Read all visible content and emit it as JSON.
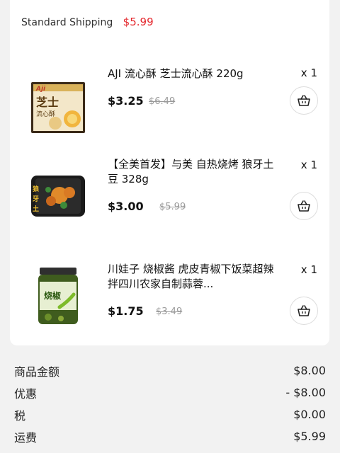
{
  "shipping": {
    "label": "Standard Shipping",
    "price": "$5.99"
  },
  "items": [
    {
      "title": "AJI 流心酥 芝士流心酥  220g",
      "qty": "x 1",
      "price": "$3.25",
      "orig_price": "$6.49"
    },
    {
      "title": "【全美首发】与美 自热烧烤 狼牙土豆 328g",
      "qty": "x 1",
      "price": "$3.00",
      "orig_price": "$5.99"
    },
    {
      "title": "川娃子 烧椒酱 虎皮青椒下饭菜超辣拌四川农家自制蒜蓉...",
      "qty": "x 1",
      "price": "$1.75",
      "orig_price": "$3.49"
    }
  ],
  "summary": [
    {
      "label": "商品金额",
      "value": "$8.00"
    },
    {
      "label": "优惠",
      "value": "- $8.00"
    },
    {
      "label": "税",
      "value": "$0.00"
    },
    {
      "label": "运费",
      "value": "$5.99"
    }
  ],
  "colors": {
    "accent": "#e4262c",
    "background": "#f2f2f2",
    "card": "#ffffff"
  },
  "icons": {
    "cart_button": "basket-icon"
  }
}
